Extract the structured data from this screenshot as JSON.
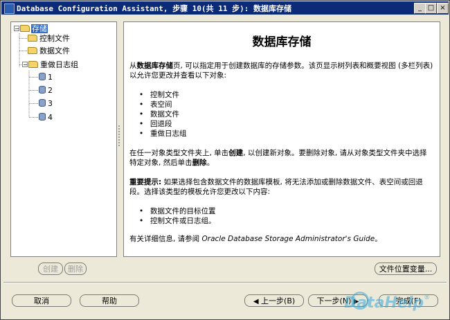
{
  "window": {
    "title": "Database Configuration Assistant, 步骤 10(共 11 步): 数据库存储",
    "buttons": {
      "minimize": "_",
      "maximize": "□",
      "close": "×"
    }
  },
  "tree": {
    "root": "存储",
    "items": [
      {
        "label": "控制文件"
      },
      {
        "label": "数据文件"
      },
      {
        "label": "重做日志组",
        "children": [
          "1",
          "2",
          "3",
          "4"
        ]
      }
    ]
  },
  "content": {
    "heading": "数据库存储",
    "intro_pre": "从",
    "intro_bold": "数据库存储",
    "intro_post": "页, 可以指定用于创建数据库的存储参数。该页显示树列表和概要视图 (多栏列表) 以允许您更改并查看以下对象:",
    "objects": [
      "控制文件",
      "表空间",
      "数据文件",
      "回退段",
      "重做日志组"
    ],
    "create_pre": "在任一对象类型文件夹上, 单击",
    "create_bold": "创建",
    "create_mid": ", 以创建新对象。要删除对象, 请从对象类型文件夹中选择特定对象, 然后单击",
    "create_bold2": "删除",
    "create_post": "。",
    "important_label": "重要提示:",
    "important_text": " 如果选择包含数据文件的数据库模板, 将无法添加或删除数据文件、表空间或回退段。选择该类型的模板允许您更改以下内容:",
    "changeables": [
      "数据文件的目标位置",
      "控制文件或日志组。"
    ],
    "more_info_pre": "有关详细信息, 请参阅 ",
    "more_info_guide": "Oracle Database Storage Administrator's Guide",
    "more_info_post": "。"
  },
  "buttons": {
    "create": "创建",
    "delete": "删除",
    "file_location_vars": "文件位置变量...",
    "cancel": "取消",
    "help": "帮助",
    "back": "上一步(B)",
    "next": "下一步(N)",
    "finish": "完成(F)"
  },
  "watermark": {
    "text": "DataHelp",
    "reg": "®"
  }
}
